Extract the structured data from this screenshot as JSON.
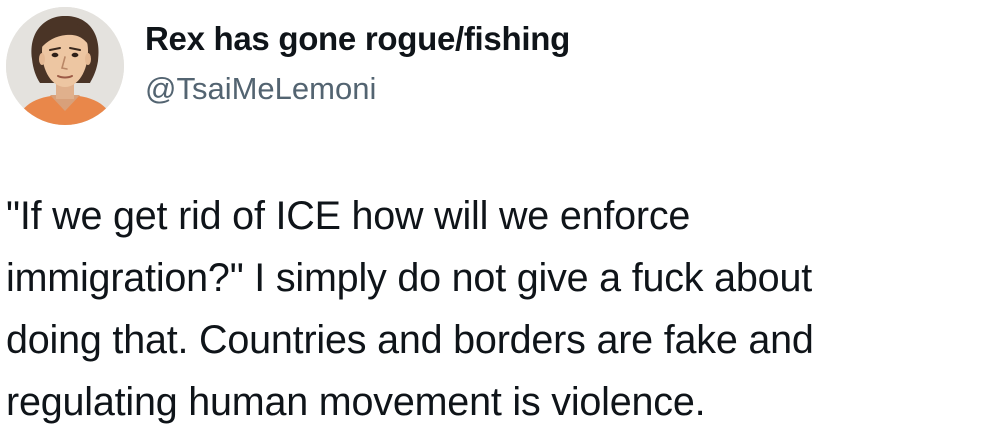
{
  "author": {
    "display_name": "Rex has gone rogue/fishing",
    "handle": "@TsaiMeLemoni",
    "avatar_icon": "illustrated-portrait-avatar"
  },
  "tweet": {
    "lines": [
      "\"If we get rid of ICE how will we enforce",
      "immigration?\" I simply do not give a fuck about",
      "doing that. Countries and borders are fake and",
      "regulating human movement is violence."
    ]
  },
  "colors": {
    "text_primary": "#0f1419",
    "text_secondary": "#536471",
    "background": "#ffffff"
  }
}
